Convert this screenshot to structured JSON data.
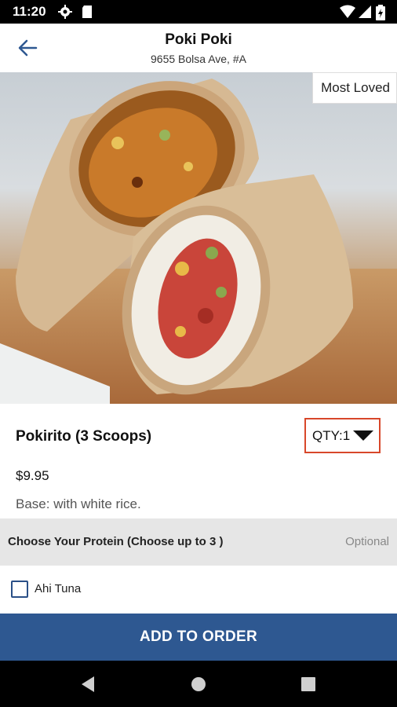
{
  "status_bar": {
    "time": "11:20"
  },
  "header": {
    "title": "Poki Poki",
    "address": "9655 Bolsa Ave, #A"
  },
  "hero": {
    "badge": "Most Loved"
  },
  "item": {
    "name": "Pokirito (3 Scoops)",
    "price": "$9.95",
    "description": "Base: with white rice.",
    "qty_label": "QTY:1"
  },
  "section": {
    "title": "Choose Your Protein (Choose up to 3 )",
    "optional_label": "Optional"
  },
  "options": [
    {
      "label": "Ahi Tuna",
      "checked": false
    }
  ],
  "footer": {
    "add_button": "ADD TO ORDER"
  },
  "colors": {
    "primary": "#2e5891",
    "qty_border": "#d8472a",
    "section_bg": "#e6e6e6"
  }
}
